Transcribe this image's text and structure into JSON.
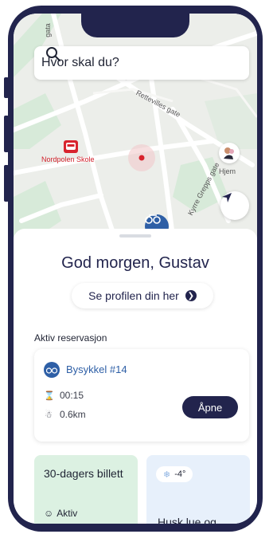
{
  "search": {
    "placeholder": "Hvor skal du?"
  },
  "map": {
    "poi_school": "Nordpolen Skole",
    "poi_home": "Hjem",
    "street_1": "Rettevilles gate",
    "street_2": "Kyrre Grepps gate",
    "street_3": "gata",
    "icons": [
      "search-icon",
      "bus-icon",
      "navigation-arrow-icon",
      "bike-icon"
    ]
  },
  "sheet": {
    "greeting": "God morgen, Gustav",
    "profile_button": "Se profilen din her"
  },
  "reservation": {
    "section_label": "Aktiv reservasjon",
    "bike_name": "Bysykkel #14",
    "duration": "00:15",
    "distance": "0.6km",
    "open_button": "Åpne"
  },
  "ticket": {
    "title": "30-dagers billett",
    "status": "Aktiv"
  },
  "weather": {
    "temperature": "-4°",
    "message": "Husk lue og"
  },
  "colors": {
    "frame": "#22244d",
    "accent_blue": "#2e5fa6",
    "school_red": "#d8232d",
    "ticket_bg": "#dcf1e2",
    "weather_bg": "#e7f0fb"
  }
}
